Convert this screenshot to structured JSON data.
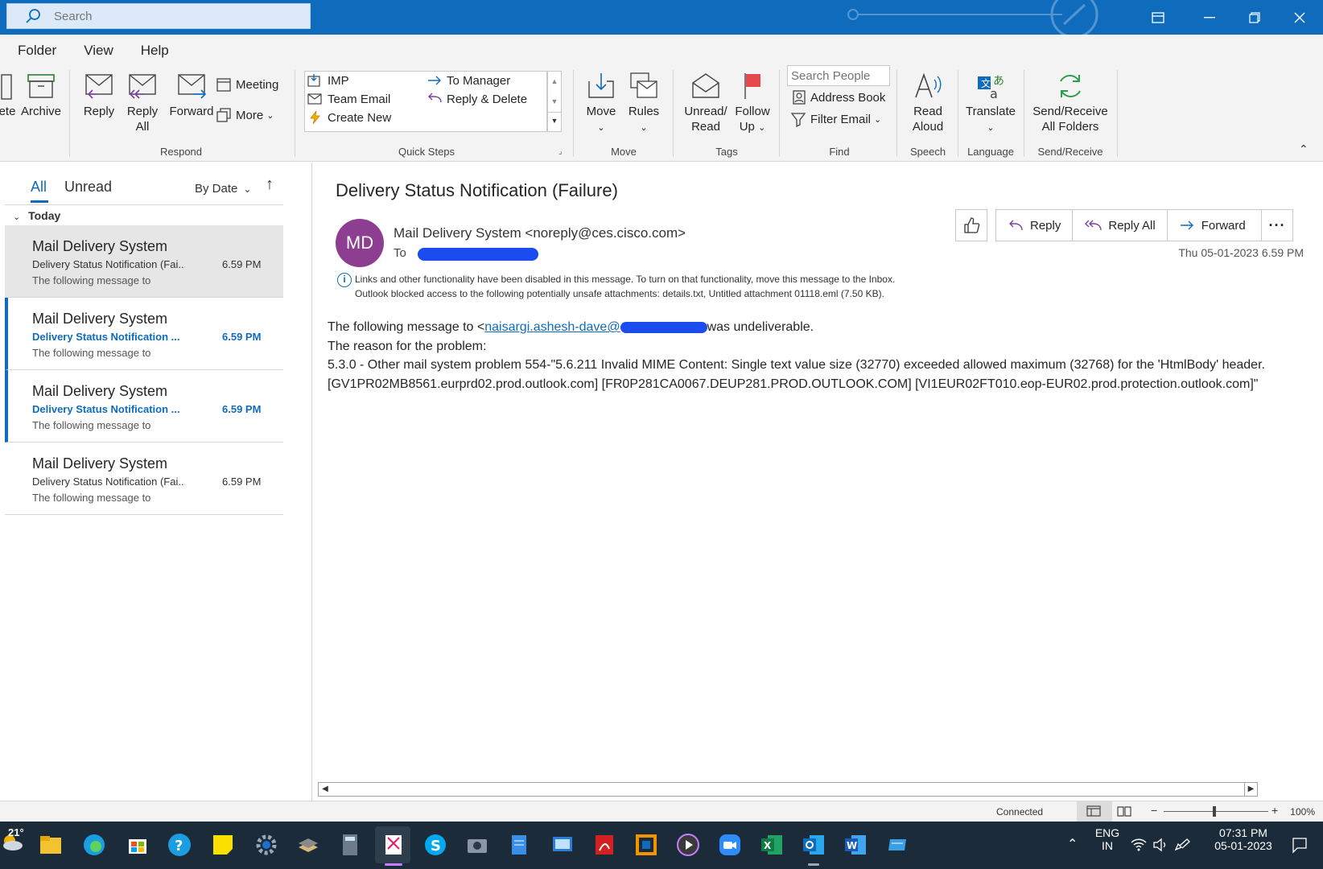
{
  "titlebar": {
    "search_placeholder": "Search"
  },
  "menu": [
    "Folder",
    "View",
    "Help"
  ],
  "ribbon": {
    "delete_partial": "ete",
    "archive": "Archive",
    "reply": "Reply",
    "reply_all_1": "Reply",
    "reply_all_2": "All",
    "forward": "Forward",
    "meeting": "Meeting",
    "more": "More",
    "respond_group": "Respond",
    "quick_steps": {
      "imp": "IMP",
      "team_email": "Team Email",
      "create_new": "Create New",
      "to_manager": "To Manager",
      "reply_delete": "Reply & Delete"
    },
    "quick_steps_group": "Quick Steps",
    "move": "Move",
    "rules": "Rules",
    "move_group": "Move",
    "unread_read_1": "Unread/",
    "unread_read_2": "Read",
    "follow_up_1": "Follow",
    "follow_up_2": "Up",
    "tags_group": "Tags",
    "search_people_placeholder": "Search People",
    "address_book": "Address Book",
    "filter_email": "Filter Email",
    "find_group": "Find",
    "read_aloud_1": "Read",
    "read_aloud_2": "Aloud",
    "speech_group": "Speech",
    "translate": "Translate",
    "language_group": "Language",
    "send_receive_1": "Send/Receive",
    "send_receive_2": "All Folders",
    "send_receive_group": "Send/Receive"
  },
  "list": {
    "tab_all": "All",
    "tab_unread": "Unread",
    "sort": "By Date",
    "section": "Today",
    "items": [
      {
        "sender": "Mail Delivery System",
        "subject": "Delivery Status Notification (Fai...",
        "time": "6.59 PM",
        "preview": "The following message to"
      },
      {
        "sender": "Mail Delivery System",
        "subject": "Delivery Status Notification ...",
        "time": "6.59 PM",
        "preview": "The following message to"
      },
      {
        "sender": "Mail Delivery System",
        "subject": "Delivery Status Notification ...",
        "time": "6.59 PM",
        "preview": "The following message to"
      },
      {
        "sender": "Mail Delivery System",
        "subject": "Delivery Status Notification (Fai...",
        "time": "6.59 PM",
        "preview": "The following message to"
      }
    ]
  },
  "message": {
    "title": "Delivery Status Notification (Failure)",
    "avatar_initials": "MD",
    "from": "Mail Delivery System <noreply@ces.cisco.com>",
    "to_label": "To",
    "date": "Thu 05-01-2023 6.59 PM",
    "info1": "Links and other functionality have been disabled in this message. To turn on that functionality, move this message to the Inbox.",
    "info2": "Outlook blocked access to the following potentially unsafe attachments: details.txt, Untitled attachment 01118.eml (7.50 KB).",
    "actions": {
      "reply": "Reply",
      "reply_all": "Reply All",
      "forward": "Forward"
    },
    "body": {
      "line1_pre": "The following message to <",
      "line1_link": "naisargi.ashesh-dave@",
      "line1_post": "was undeliverable.",
      "line2": "The reason for the problem:",
      "line3": "5.3.0 - Other mail system problem 554-\"5.6.211 Invalid MIME Content: Single text value size (32770) exceeded allowed maximum (32768) for the 'HtmlBody' header. [GV1PR02MB8561.eurprd02.prod.outlook.com] [FR0P281CA0067.DEUP281.PROD.OUTLOOK.COM] [VI1EUR02FT010.eop-EUR02.prod.protection.outlook.com]\""
    }
  },
  "status": {
    "connected": "Connected",
    "zoom": "100%"
  },
  "taskbar": {
    "weather": "21°",
    "lang1": "ENG",
    "lang2": "IN",
    "time": "07:31 PM",
    "date": "05-01-2023"
  }
}
